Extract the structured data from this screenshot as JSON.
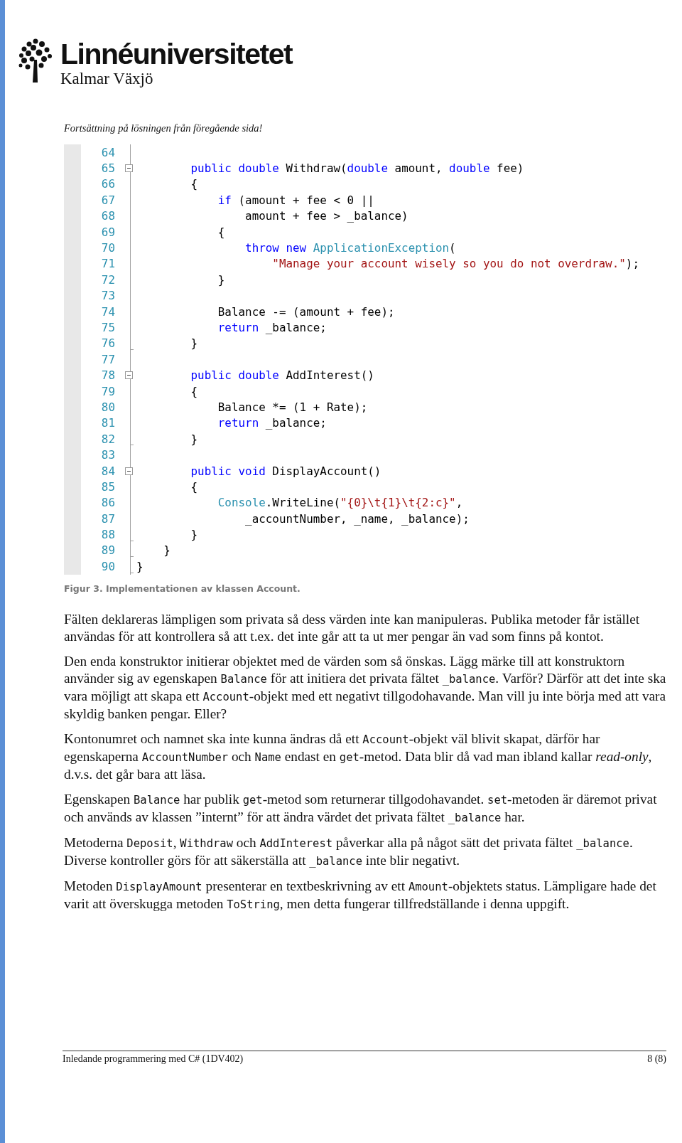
{
  "header": {
    "logo_name": "Linnéuniversitetet",
    "logo_sub": "Kalmar Växjö"
  },
  "intro": "Fortsättning på lösningen från föregående sida!",
  "code": {
    "lines": [
      {
        "number": "64"
      },
      {
        "number": "65",
        "kind": "fold_start",
        "segments": [
          {
            "kind": "keyword",
            "text": "        public double "
          },
          {
            "kind": "plain",
            "text": "Withdraw("
          },
          {
            "kind": "keyword",
            "text": "double"
          },
          {
            "kind": "plain",
            "text": " amount, "
          },
          {
            "kind": "keyword",
            "text": "double"
          },
          {
            "kind": "plain",
            "text": " fee)"
          }
        ]
      },
      {
        "number": "66",
        "segments": [
          {
            "kind": "plain",
            "text": "        {"
          }
        ]
      },
      {
        "number": "67",
        "segments": [
          {
            "kind": "keyword",
            "text": "            if"
          },
          {
            "kind": "plain",
            "text": " (amount + fee < 0 ||"
          }
        ]
      },
      {
        "number": "68",
        "segments": [
          {
            "kind": "plain",
            "text": "                amount + fee > _balance)"
          }
        ]
      },
      {
        "number": "69",
        "segments": [
          {
            "kind": "plain",
            "text": "            {"
          }
        ]
      },
      {
        "number": "70",
        "segments": [
          {
            "kind": "keyword",
            "text": "                throw new "
          },
          {
            "kind": "type",
            "text": "ApplicationException"
          },
          {
            "kind": "plain",
            "text": "("
          }
        ]
      },
      {
        "number": "71",
        "segments": [
          {
            "kind": "string",
            "text": "                    \"Manage your account wisely so you do not overdraw.\""
          },
          {
            "kind": "plain",
            "text": ");"
          }
        ]
      },
      {
        "number": "72",
        "segments": [
          {
            "kind": "plain",
            "text": "            }"
          }
        ]
      },
      {
        "number": "73"
      },
      {
        "number": "74",
        "segments": [
          {
            "kind": "plain",
            "text": "            Balance -= (amount + fee);"
          }
        ]
      },
      {
        "number": "75",
        "segments": [
          {
            "kind": "keyword",
            "text": "            return"
          },
          {
            "kind": "plain",
            "text": " _balance;"
          }
        ]
      },
      {
        "number": "76",
        "kind": "fold_end",
        "segments": [
          {
            "kind": "plain",
            "text": "        }"
          }
        ]
      },
      {
        "number": "77"
      },
      {
        "number": "78",
        "kind": "fold_start",
        "segments": [
          {
            "kind": "keyword",
            "text": "        public double "
          },
          {
            "kind": "plain",
            "text": "AddInterest()"
          }
        ]
      },
      {
        "number": "79",
        "segments": [
          {
            "kind": "plain",
            "text": "        {"
          }
        ]
      },
      {
        "number": "80",
        "segments": [
          {
            "kind": "plain",
            "text": "            Balance *= (1 + Rate);"
          }
        ]
      },
      {
        "number": "81",
        "segments": [
          {
            "kind": "keyword",
            "text": "            return"
          },
          {
            "kind": "plain",
            "text": " _balance;"
          }
        ]
      },
      {
        "number": "82",
        "kind": "fold_end",
        "segments": [
          {
            "kind": "plain",
            "text": "        }"
          }
        ]
      },
      {
        "number": "83"
      },
      {
        "number": "84",
        "kind": "fold_start",
        "segments": [
          {
            "kind": "keyword",
            "text": "        public void "
          },
          {
            "kind": "plain",
            "text": "DisplayAccount()"
          }
        ]
      },
      {
        "number": "85",
        "segments": [
          {
            "kind": "plain",
            "text": "        {"
          }
        ]
      },
      {
        "number": "86",
        "segments": [
          {
            "kind": "type",
            "text": "            Console"
          },
          {
            "kind": "plain",
            "text": ".WriteLine("
          },
          {
            "kind": "string",
            "text": "\"{0}\\t{1}\\t{2:c}\""
          },
          {
            "kind": "plain",
            "text": ","
          }
        ]
      },
      {
        "number": "87",
        "segments": [
          {
            "kind": "plain",
            "text": "                _accountNumber, _name, _balance);"
          }
        ]
      },
      {
        "number": "88",
        "kind": "fold_end",
        "segments": [
          {
            "kind": "plain",
            "text": "        }"
          }
        ]
      },
      {
        "number": "89",
        "kind": "fold_end",
        "segments": [
          {
            "kind": "plain",
            "text": "    }"
          }
        ]
      },
      {
        "number": "90",
        "kind": "fold_end",
        "segments": [
          {
            "kind": "plain",
            "text": "}"
          }
        ]
      }
    ]
  },
  "caption": "Figur 3. Implementationen av klassen Account.",
  "paragraphs": [
    [
      {
        "kind": "text",
        "text": "Fälten deklareras lämpligen som privata så dess värden inte kan manipuleras. Publika metoder får istället användas för att kontrollera så att t.ex. det inte går att ta ut mer pengar än vad som finns på kontot."
      }
    ],
    [
      {
        "kind": "text",
        "text": "Den enda konstruktor initierar objektet med de värden som så önskas. Lägg märke till att konstruktorn använder sig av egenskapen "
      },
      {
        "kind": "code",
        "text": "Balance"
      },
      {
        "kind": "text",
        "text": " för att initiera det privata fältet "
      },
      {
        "kind": "code",
        "text": "_balance"
      },
      {
        "kind": "text",
        "text": ". Varför? Därför att det inte ska vara möjligt att skapa ett "
      },
      {
        "kind": "code",
        "text": "Account"
      },
      {
        "kind": "text",
        "text": "-objekt med ett negativt tillgodohavande. Man vill ju inte börja med att vara skyldig banken pengar. Eller?"
      }
    ],
    [
      {
        "kind": "text",
        "text": "Kontonumret och namnet ska inte kunna ändras då ett "
      },
      {
        "kind": "code",
        "text": "Account"
      },
      {
        "kind": "text",
        "text": "-objekt väl blivit skapat, därför har egenskaperna "
      },
      {
        "kind": "code",
        "text": "AccountNumber"
      },
      {
        "kind": "text",
        "text": " och "
      },
      {
        "kind": "code",
        "text": "Name"
      },
      {
        "kind": "text",
        "text": " endast en "
      },
      {
        "kind": "code",
        "text": "get"
      },
      {
        "kind": "text",
        "text": "-metod. Data blir då vad man ibland kallar "
      },
      {
        "kind": "italic",
        "text": "read-only"
      },
      {
        "kind": "text",
        "text": ", d.v.s. det går bara att läsa."
      }
    ],
    [
      {
        "kind": "text",
        "text": "Egenskapen "
      },
      {
        "kind": "code",
        "text": "Balance"
      },
      {
        "kind": "text",
        "text": " har publik "
      },
      {
        "kind": "code",
        "text": "get"
      },
      {
        "kind": "text",
        "text": "-metod som returnerar tillgodohavandet. "
      },
      {
        "kind": "code",
        "text": "set"
      },
      {
        "kind": "text",
        "text": "-metoden är däremot privat och används av klassen ”internt” för att ändra värdet det privata fältet "
      },
      {
        "kind": "code",
        "text": "_balance"
      },
      {
        "kind": "text",
        "text": " har."
      }
    ],
    [
      {
        "kind": "text",
        "text": "Metoderna "
      },
      {
        "kind": "code",
        "text": "Deposit"
      },
      {
        "kind": "text",
        "text": ", "
      },
      {
        "kind": "code",
        "text": "Withdraw"
      },
      {
        "kind": "text",
        "text": " och "
      },
      {
        "kind": "code",
        "text": "AddInterest"
      },
      {
        "kind": "text",
        "text": " påverkar alla på något sätt det privata fältet "
      },
      {
        "kind": "code",
        "text": "_balance"
      },
      {
        "kind": "text",
        "text": ". Diverse kontroller görs för att säkerställa att "
      },
      {
        "kind": "code",
        "text": "_balance"
      },
      {
        "kind": "text",
        "text": " inte blir negativt."
      }
    ],
    [
      {
        "kind": "text",
        "text": "Metoden "
      },
      {
        "kind": "code",
        "text": "DisplayAmount"
      },
      {
        "kind": "text",
        "text": " presenterar en textbeskrivning av ett "
      },
      {
        "kind": "code",
        "text": "Amount"
      },
      {
        "kind": "text",
        "text": "-objektets status. Lämpligare hade det varit att överskugga metoden "
      },
      {
        "kind": "code",
        "text": "ToString"
      },
      {
        "kind": "text",
        "text": ", men detta fungerar tillfredställande i denna uppgift."
      }
    ]
  ],
  "footer": {
    "title": "Inledande programmering med C# (1DV402)",
    "page": "8 (8)"
  }
}
